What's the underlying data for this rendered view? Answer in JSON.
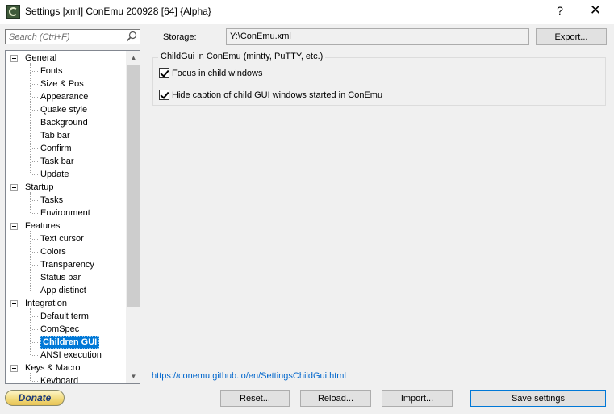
{
  "window": {
    "title": "Settings [xml] ConEmu 200928 [64] {Alpha}",
    "help_label": "?",
    "close_label": "✕"
  },
  "search": {
    "placeholder": "Search (Ctrl+F)"
  },
  "tree": {
    "groups": [
      {
        "label": "General",
        "children": [
          "Fonts",
          "Size & Pos",
          "Appearance",
          "Quake style",
          "Background",
          "Tab bar",
          "Confirm",
          "Task bar",
          "Update"
        ]
      },
      {
        "label": "Startup",
        "children": [
          "Tasks",
          "Environment"
        ]
      },
      {
        "label": "Features",
        "children": [
          "Text cursor",
          "Colors",
          "Transparency",
          "Status bar",
          "App distinct"
        ]
      },
      {
        "label": "Integration",
        "children": [
          "Default term",
          "ComSpec",
          "Children GUI",
          "ANSI execution"
        ]
      },
      {
        "label": "Keys & Macro",
        "children": [
          "Keyboard"
        ]
      }
    ],
    "selected": "Children GUI"
  },
  "storage": {
    "label": "Storage:",
    "value": "Y:\\ConEmu.xml",
    "export_label": "Export..."
  },
  "childgui": {
    "group_title": "ChildGui in ConEmu (mintty, PuTTY, etc.)",
    "focus_label": "Focus in child windows",
    "focus_checked": true,
    "hide_caption_label": "Hide caption of child GUI windows started in ConEmu",
    "hide_caption_checked": true
  },
  "help_link": "https://conemu.github.io/en/SettingsChildGui.html",
  "footer": {
    "donate_label": "Donate",
    "reset_label": "Reset...",
    "reload_label": "Reload...",
    "import_label": "Import...",
    "save_label": "Save settings"
  }
}
